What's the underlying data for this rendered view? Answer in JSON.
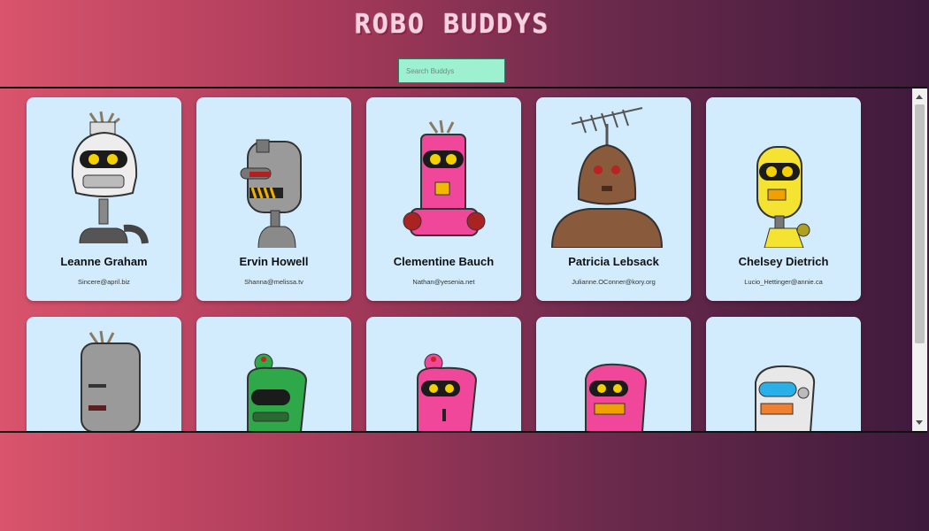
{
  "app": {
    "title": "ROBO BUDDYS"
  },
  "search": {
    "placeholder": "Search Buddys",
    "value": ""
  },
  "robots": [
    {
      "name": "Leanne Graham",
      "email": "Sincere@april.biz"
    },
    {
      "name": "Ervin Howell",
      "email": "Shanna@melissa.tv"
    },
    {
      "name": "Clementine Bauch",
      "email": "Nathan@yesenia.net"
    },
    {
      "name": "Patricia Lebsack",
      "email": "Julianne.OConner@kory.org"
    },
    {
      "name": "Chelsey Dietrich",
      "email": "Lucio_Hettinger@annie.ca"
    },
    {
      "name": "",
      "email": ""
    },
    {
      "name": "",
      "email": ""
    },
    {
      "name": "",
      "email": ""
    },
    {
      "name": "",
      "email": ""
    },
    {
      "name": "",
      "email": ""
    }
  ],
  "colors": {
    "card_bg": "#d2ecfd",
    "search_bg": "#9df0d0",
    "robot_colors": [
      "#e8e8e8",
      "#9a9a9a",
      "#f0479a",
      "#8a5a3c",
      "#f4e330",
      "#9a9a9a",
      "#2fa84a",
      "#f0479a",
      "#f0479a",
      "#e8e8e8"
    ]
  }
}
